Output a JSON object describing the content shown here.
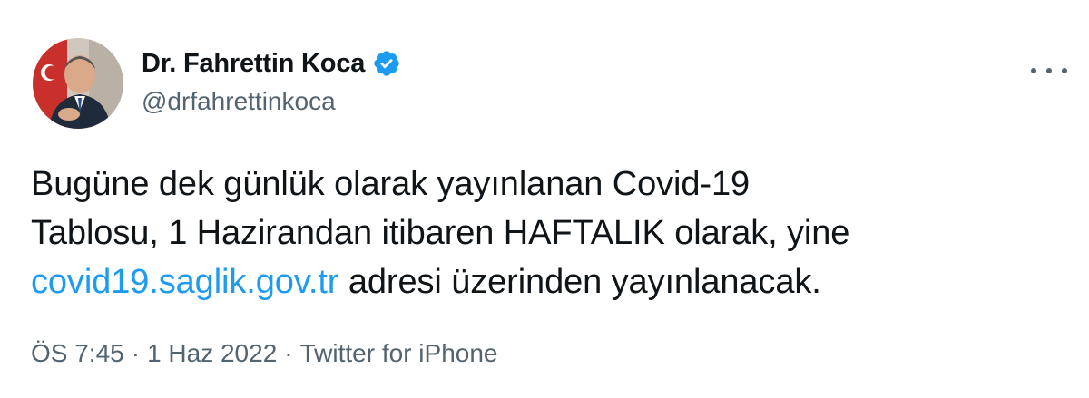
{
  "tweet": {
    "author": {
      "display_name": "Dr. Fahrettin Koca",
      "handle": "@drfahrettinkoca",
      "verified": true
    },
    "more_icon": "more-horizontal-icon",
    "text": {
      "part1": "Bugüne dek günlük olarak yayınlanan Covid-19",
      "part2": "Tablosu, 1 Hazirandan itibaren HAFTALIK olarak, yine",
      "link": "covid19.saglik.gov.tr",
      "part3": " adresi üzerinden yayınlanacak."
    },
    "meta": {
      "time": "ÖS 7:45",
      "separator": "·",
      "date": "1 Haz 2022",
      "source": "Twitter for iPhone"
    },
    "colors": {
      "link": "#1d9bf0",
      "secondary_text": "#536471",
      "verified_badge": "#1d9bf0"
    }
  }
}
